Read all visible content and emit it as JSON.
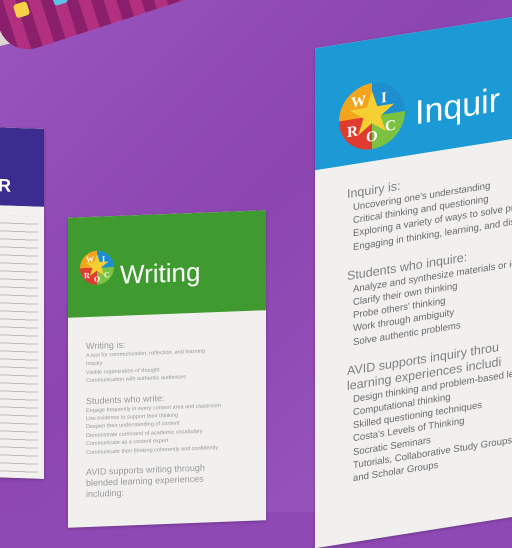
{
  "scene": {
    "wall_color": "#8f49b4",
    "left_poster": {
      "title_fragment": "R"
    },
    "writing_poster": {
      "title": "Writing",
      "header_color": "#3f9b2f",
      "logo_letters": [
        "W",
        "I",
        "R",
        "O",
        "C"
      ],
      "section1_heading": "Writing is:",
      "section1_items": [
        "A tool for communication, reflection, and learning",
        "Inquiry",
        "Visible organization of thought",
        "Communication with authentic audiences"
      ],
      "section2_heading": "Students who write:",
      "section2_items": [
        "Engage frequently in every content area and classroom",
        "Use evidence to support their thinking",
        "Deepen their understanding of content",
        "Demonstrate command of academic vocabulary",
        "Communicate as a content expert",
        "Communicate their thinking coherently and confidently"
      ],
      "section3_heading": "AVID supports writing through blended learning experiences including:"
    },
    "inquiry_poster": {
      "title": "Inquir",
      "header_color": "#1c9ad6",
      "logo_letters": [
        "W",
        "I",
        "R",
        "O",
        "C"
      ],
      "section1_heading": "Inquiry is:",
      "section1_items": [
        "Uncovering one's understanding",
        "Critical thinking and questioning",
        "Exploring a variety of ways to solve problem",
        "Engaging in thinking, learning, and discussi"
      ],
      "section2_heading": "Students who inquire:",
      "section2_items": [
        "Analyze and synthesize materials or ideas",
        "Clarify their own thinking",
        "Probe others' thinking",
        "Work through ambiguity",
        "Solve authentic problems"
      ],
      "section3_heading_line1": "AVID supports inquiry throu",
      "section3_heading_line2": "learning experiences includi",
      "section3_items": [
        "Design thinking and problem-based learnin",
        "Computational thinking",
        "Skilled questioning techniques",
        "Costa's Levels of Thinking",
        "Socratic Seminars",
        "Tutorials, Collaborative Study Groups,",
        "and Scholar Groups"
      ]
    }
  }
}
